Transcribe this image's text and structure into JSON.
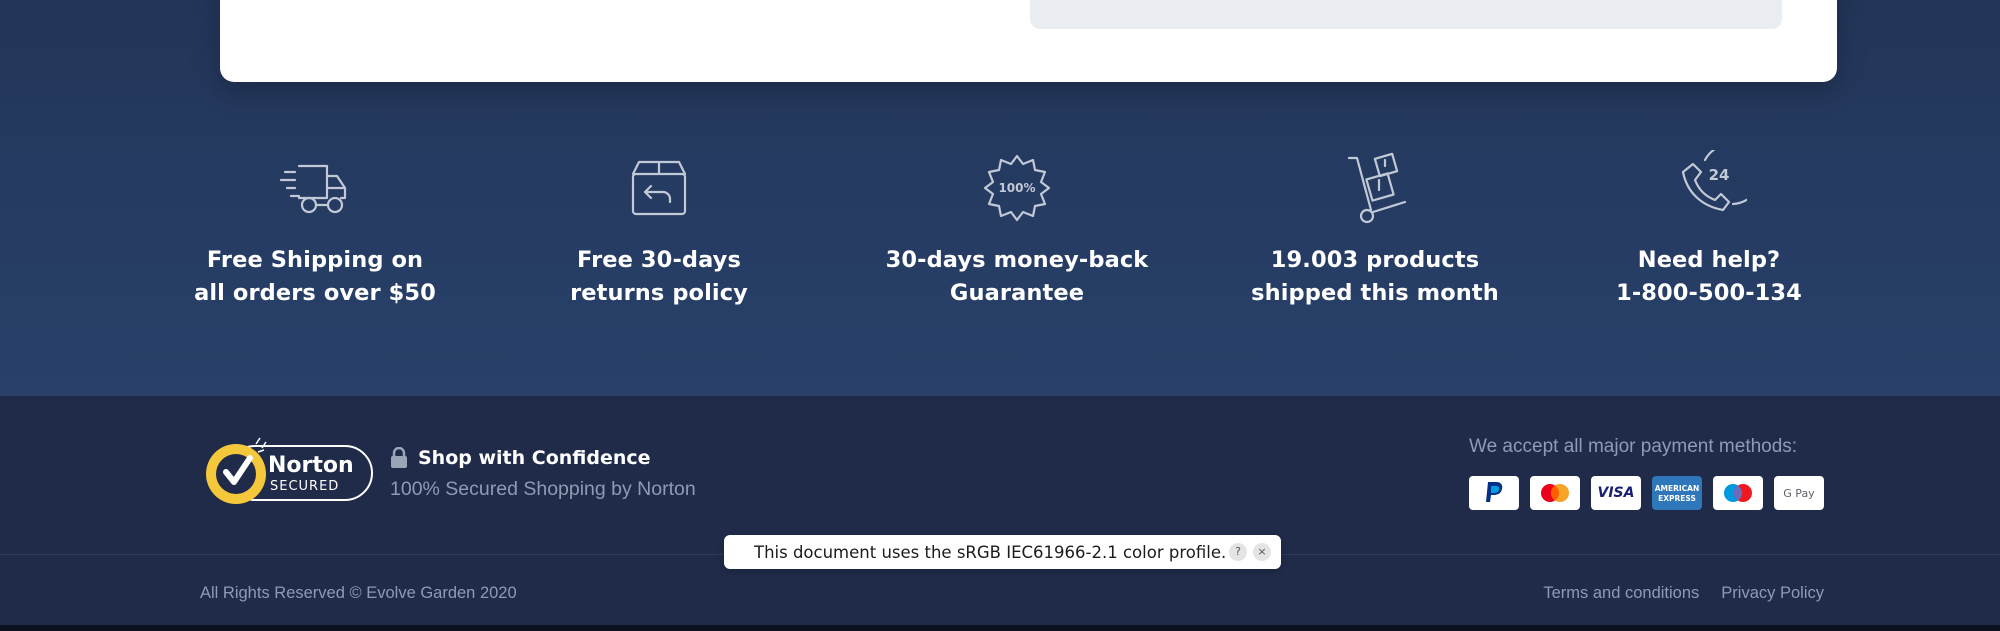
{
  "features": [
    {
      "icon": "fast-delivery-truck-icon",
      "line1": "Free Shipping on",
      "line2": "all orders over $50"
    },
    {
      "icon": "return-box-icon",
      "line1": "Free 30-days",
      "line2": "returns policy"
    },
    {
      "icon": "guarantee-badge-icon",
      "line1": "30-days money-back",
      "line2": "Guarantee",
      "badge_text": "100%"
    },
    {
      "icon": "hand-truck-icon",
      "line1": "19.003 products",
      "line2": "shipped this month"
    },
    {
      "icon": "support-phone-24-icon",
      "line1": "Need help?",
      "line2": "1-800-500-134",
      "badge_text": "24"
    }
  ],
  "trust": {
    "norton_brand": "Norton",
    "norton_sub": "SECURED",
    "title": "Shop with Confidence",
    "subtitle": "100% Secured Shopping by Norton"
  },
  "payments": {
    "label": "We accept all major payment methods:",
    "cards": [
      {
        "icon": "paypal-icon",
        "name": "PayPal"
      },
      {
        "icon": "mastercard-icon",
        "name": "Mastercard"
      },
      {
        "icon": "visa-icon",
        "name": "VISA"
      },
      {
        "icon": "amex-icon",
        "name": "American Express"
      },
      {
        "icon": "maestro-icon",
        "name": "Maestro"
      },
      {
        "icon": "google-pay-icon",
        "name": "G Pay"
      }
    ]
  },
  "footer": {
    "copyright": "All Rights Reserved © Evolve Garden 2020",
    "links": [
      "Terms and conditions",
      "Privacy Policy"
    ]
  },
  "toast": {
    "message": "This document uses the sRGB IEC61966-2.1 color profile.",
    "help_label": "?",
    "close_label": "×"
  },
  "colors": {
    "band_top": "#233659",
    "band_bottom": "#28406a",
    "footer_bg": "#1f2b49",
    "muted_text": "#8e9bb3",
    "norton_yellow": "#f5c73b"
  }
}
